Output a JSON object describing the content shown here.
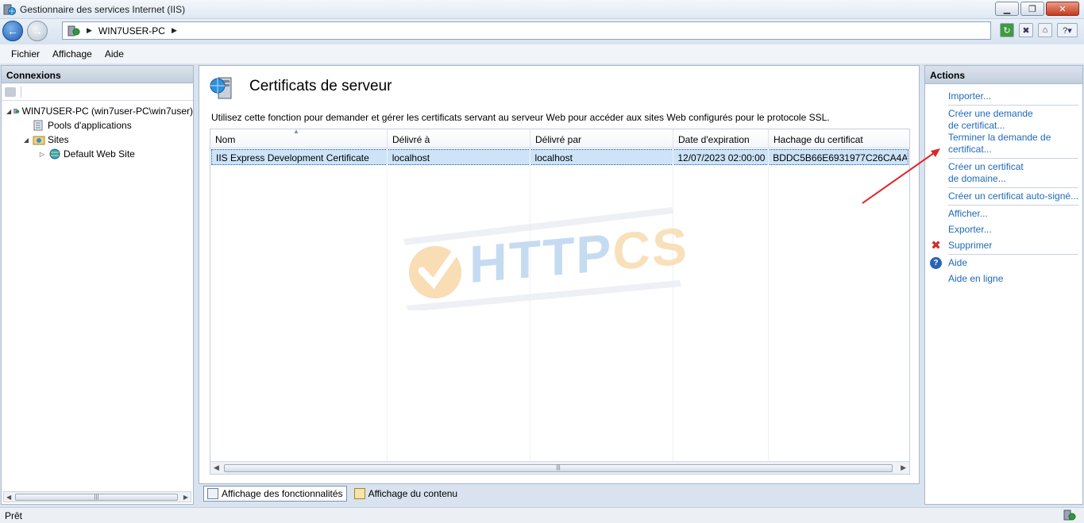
{
  "window": {
    "title": "Gestionnaire des services Internet (IIS)",
    "buttons": {
      "minimize": "▁",
      "restore": "❐",
      "close": "✕"
    }
  },
  "addressbar": {
    "crumbs": [
      "WIN7USER-PC"
    ]
  },
  "menu": {
    "items": [
      "Fichier",
      "Affichage",
      "Aide"
    ]
  },
  "connections": {
    "header": "Connexions",
    "tree": [
      {
        "label": "WIN7USER-PC (win7user-PC\\win7user)",
        "level": 0,
        "expanded": true,
        "icon": "server-icon"
      },
      {
        "label": "Pools d'applications",
        "level": 1,
        "expanded": null,
        "icon": "app-pools-icon"
      },
      {
        "label": "Sites",
        "level": 1,
        "expanded": true,
        "icon": "sites-folder-icon"
      },
      {
        "label": "Default Web Site",
        "level": 2,
        "expanded": false,
        "icon": "globe-icon"
      }
    ]
  },
  "main": {
    "title": "Certificats de serveur",
    "description": "Utilisez cette fonction pour demander et gérer les certificats servant au serveur Web pour accéder aux sites Web configurés pour le protocole SSL.",
    "columns": [
      "Nom",
      "Délivré à",
      "Délivré par",
      "Date d'expiration",
      "Hachage du certificat"
    ],
    "rows": [
      [
        "IIS Express Development Certificate",
        "localhost",
        "localhost",
        "12/07/2023 02:00:00",
        "BDDC5B66E6931977C26CA4A..."
      ]
    ]
  },
  "watermark": {
    "text_a": "HTTP",
    "text_b": "CS"
  },
  "view_tabs": {
    "features": "Affichage des fonctionnalités",
    "content": "Affichage du contenu"
  },
  "actions": {
    "header": "Actions",
    "items": [
      {
        "label": "Importer...",
        "icon": null
      },
      {
        "sep": true
      },
      {
        "label": "Créer une demande de certificat...",
        "icon": null
      },
      {
        "label": "Terminer la demande de certificat...",
        "icon": null
      },
      {
        "sep": true
      },
      {
        "label": "Créer un certificat de domaine...",
        "icon": null
      },
      {
        "sep": true
      },
      {
        "label": "Créer un certificat auto-signé...",
        "icon": null
      },
      {
        "sep": true
      },
      {
        "label": "Afficher...",
        "icon": null
      },
      {
        "label": "Exporter...",
        "icon": null
      },
      {
        "label": "Supprimer",
        "icon": "delete-x-icon"
      },
      {
        "sep": true
      },
      {
        "label": "Aide",
        "icon": "help-icon"
      },
      {
        "label": "Aide en ligne",
        "icon": null
      }
    ]
  },
  "status": {
    "text": "Prêt"
  },
  "colors": {
    "link": "#1f6ab8",
    "selection": "#cde4f8",
    "annotation": "#e0262a"
  }
}
